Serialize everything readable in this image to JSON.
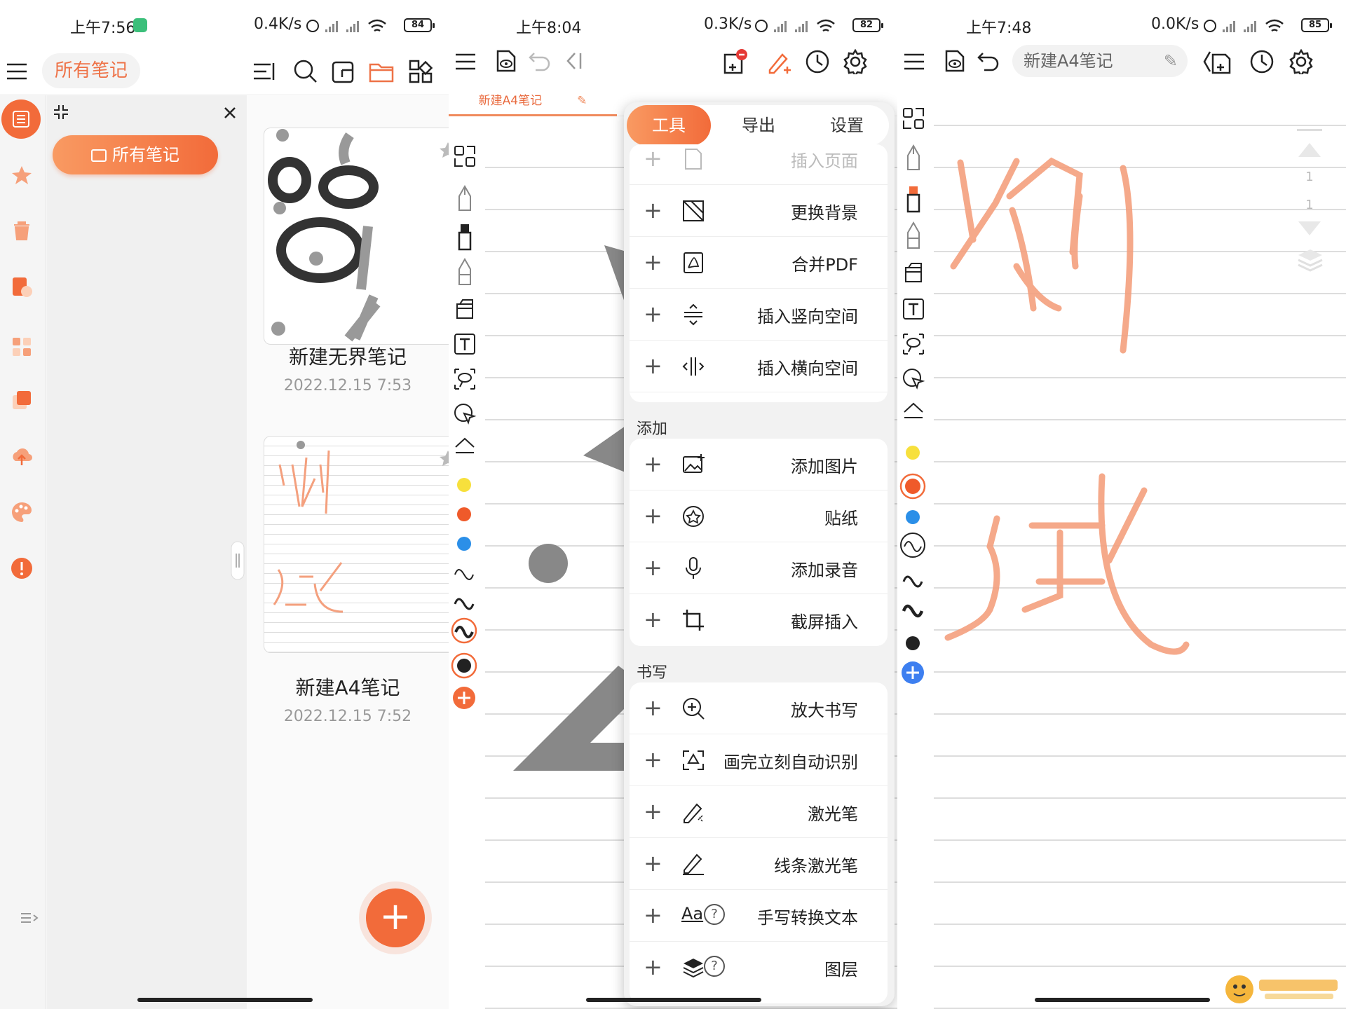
{
  "panel1": {
    "status": {
      "time": "上午7:56",
      "speed": "0.4K/s",
      "battery": "84"
    },
    "folder_chip": "所有笔记",
    "all_notes_button": "所有笔记",
    "notes": [
      {
        "title": "新建无界笔记",
        "date": "2022.12.15 7:53"
      },
      {
        "title": "新建A4笔记",
        "date": "2022.12.15 7:52"
      }
    ],
    "fab": "+",
    "colors": {
      "accent": "#f26b3a"
    }
  },
  "panel2": {
    "status": {
      "time": "上午8:04",
      "speed": "0.3K/s",
      "battery": "82"
    },
    "doc_tab": "新建A4笔记",
    "menu_tabs": [
      "工具",
      "导出",
      "设置"
    ],
    "tool_rows": [
      "插入页面",
      "更换背景",
      "合并PDF",
      "插入竖向空间",
      "插入横向空间"
    ],
    "add_section": "添加",
    "add_rows": [
      "添加图片",
      "贴纸",
      "添加录音",
      "截屏插入"
    ],
    "write_section": "书写",
    "write_rows": [
      "放大书写",
      "画完立刻自动识别",
      "激光笔",
      "线条激光笔",
      "手写转换文本",
      "图层"
    ],
    "pen_colors": [
      "#f7e03c",
      "#ef5a2a",
      "#2b8fe8",
      "#222222"
    ]
  },
  "panel3": {
    "status": {
      "time": "上午7:48",
      "speed": "0.0K/s",
      "battery": "85"
    },
    "title": "新建A4笔记",
    "page_nav": [
      "1",
      "1"
    ],
    "ink_color": "#f4a07e"
  }
}
